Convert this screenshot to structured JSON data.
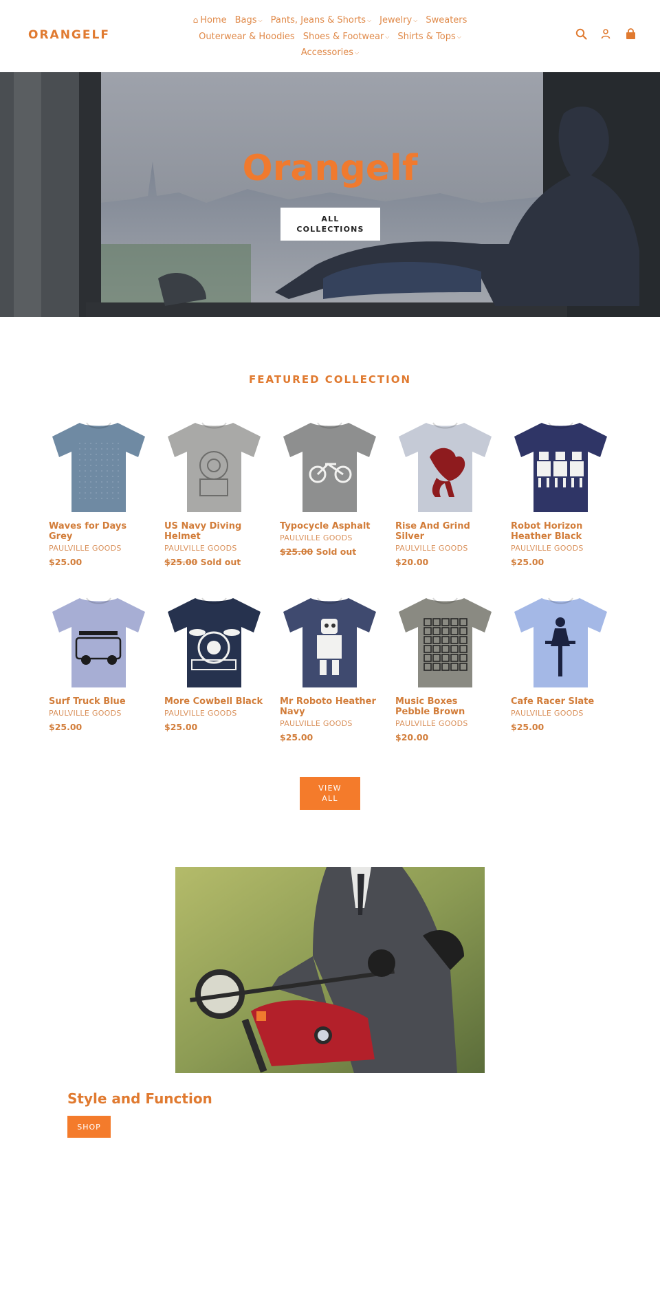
{
  "header": {
    "logo": "ORANGELF",
    "nav_rows": [
      [
        {
          "label": "Home",
          "icon": "home-icon",
          "dropdown": false
        },
        {
          "label": "Bags",
          "dropdown": true
        },
        {
          "label": "Pants, Jeans & Shorts",
          "dropdown": true
        },
        {
          "label": "Jewelry",
          "dropdown": true
        },
        {
          "label": "Sweaters",
          "dropdown": false
        }
      ],
      [
        {
          "label": "Outerwear & Hoodies",
          "dropdown": false
        },
        {
          "label": "Shoes & Footwear",
          "dropdown": true
        },
        {
          "label": "Shirts & Tops",
          "dropdown": true
        }
      ],
      [
        {
          "label": "Accessories",
          "dropdown": true
        }
      ]
    ],
    "icons": [
      "search-icon",
      "account-icon",
      "cart-icon"
    ]
  },
  "hero": {
    "title": "Orangelf",
    "button_label_line1": "ALL",
    "button_label_line2": "COLLECTIONS"
  },
  "featured": {
    "title": "FEATURED COLLECTION",
    "products": [
      {
        "name": "Waves for Days Grey",
        "vendor": "PAULVILLE GOODS",
        "price": "$25.00",
        "sold_out": false,
        "shirt_color": "#6f8aa3",
        "print": "dots"
      },
      {
        "name": "US Navy Diving Helmet",
        "vendor": "PAULVILLE GOODS",
        "price": "$25.00",
        "sold_out": true,
        "sold_out_label": "Sold out",
        "shirt_color": "#a9a9a7",
        "print": "helmet"
      },
      {
        "name": "Typocycle Asphalt",
        "vendor": "PAULVILLE GOODS",
        "price": "$25.00",
        "sold_out": true,
        "sold_out_label": "Sold out",
        "shirt_color": "#8e8f8f",
        "print": "bike"
      },
      {
        "name": "Rise And Grind Silver",
        "vendor": "PAULVILLE GOODS",
        "price": "$20.00",
        "sold_out": false,
        "shirt_color": "#c5cad6",
        "print": "rooster"
      },
      {
        "name": "Robot Horizon Heather Black",
        "vendor": "PAULVILLE GOODS",
        "price": "$25.00",
        "sold_out": false,
        "shirt_color": "#2f3566",
        "print": "robots"
      },
      {
        "name": "Surf Truck Blue",
        "vendor": "PAULVILLE GOODS",
        "price": "$25.00",
        "sold_out": false,
        "shirt_color": "#a7aed4",
        "print": "truck"
      },
      {
        "name": "More Cowbell Black",
        "vendor": "PAULVILLE GOODS",
        "price": "$25.00",
        "sold_out": false,
        "shirt_color": "#26324e",
        "print": "drums"
      },
      {
        "name": "Mr Roboto Heather Navy",
        "vendor": "PAULVILLE GOODS",
        "price": "$25.00",
        "sold_out": false,
        "shirt_color": "#3f4a6f",
        "print": "robot"
      },
      {
        "name": "Music Boxes Pebble Brown",
        "vendor": "PAULVILLE GOODS",
        "price": "$20.00",
        "sold_out": false,
        "shirt_color": "#8a8a82",
        "print": "boxes"
      },
      {
        "name": "Cafe Racer Slate",
        "vendor": "PAULVILLE GOODS",
        "price": "$25.00",
        "sold_out": false,
        "shirt_color": "#a4b8e6",
        "print": "rider"
      }
    ],
    "view_all_line1": "VIEW",
    "view_all_line2": "ALL"
  },
  "feature": {
    "title": "Style and Function",
    "button_label": "SHOP"
  },
  "colors": {
    "accent": "#f47b2b",
    "text_orange": "#d27d3a"
  }
}
